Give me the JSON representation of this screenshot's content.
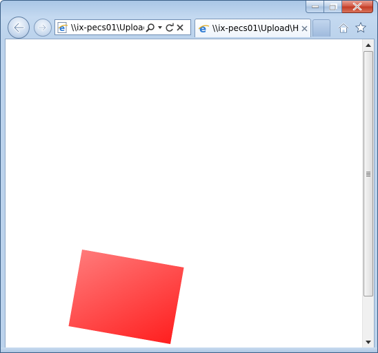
{
  "window": {
    "address": "\\\\ix-pecs01\\Upload",
    "tab_title": "\\\\ix-pecs01\\Upload\\H...",
    "accent_color": "#3b5f87"
  },
  "icons": {
    "back": "back-arrow-icon",
    "forward": "forward-arrow-icon",
    "page": "ie-page-icon",
    "search": "search-icon",
    "dropdown": "chevron-down-icon",
    "refresh": "refresh-icon",
    "stop": "close-icon",
    "home": "home-icon",
    "favorites": "star-icon"
  },
  "content": {
    "shape_color": "#ff2a2a"
  }
}
